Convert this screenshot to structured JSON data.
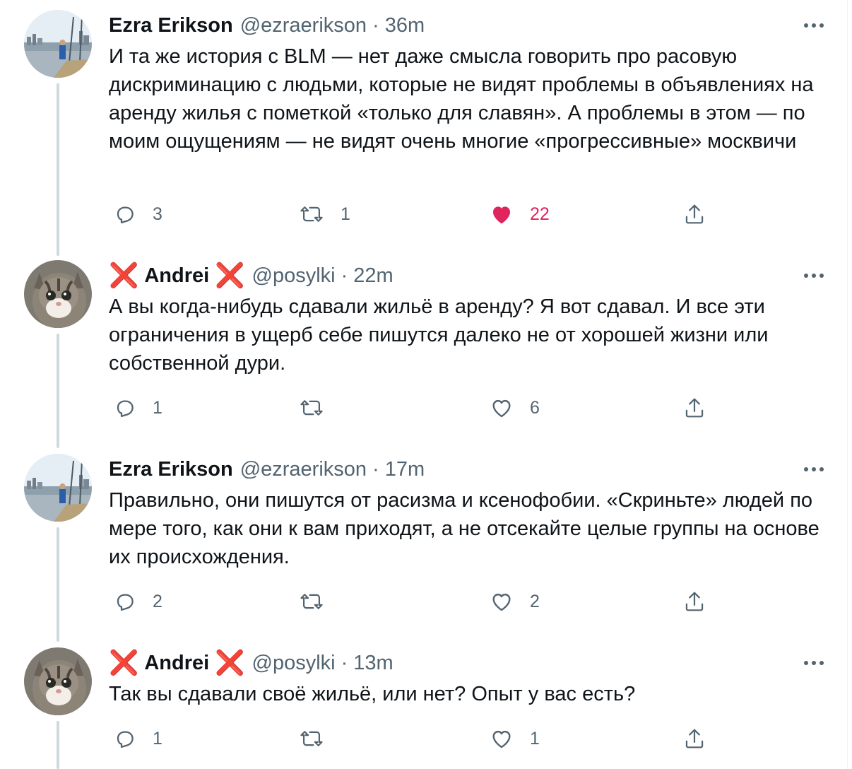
{
  "tweets": [
    {
      "name": "Ezra Erikson",
      "handle": "@ezraerikson",
      "time": "36m",
      "text": "И та же история с BLM — нет даже смысла говорить про расовую дискриминацию с людьми, которые не видят проблемы в объявлениях на аренду жилья с пометкой «только для славян». А проблемы в этом — по моим ощущениям — не видят очень многие «прогрессивные» москвичи",
      "replies": "3",
      "retweets": "1",
      "likes": "22",
      "liked": true
    },
    {
      "name": "Andrei",
      "handle": "@posylki",
      "time": "22m",
      "text": "А вы когда-нибудь сдавали жильё в аренду? Я вот сдавал. И все эти ограничения в ущерб себе пишутся далеко не от хорошей жизни или собственной дури.",
      "replies": "1",
      "retweets": "",
      "likes": "6",
      "liked": false
    },
    {
      "name": "Ezra Erikson",
      "handle": "@ezraerikson",
      "time": "17m",
      "text": "Правильно, они пишутся от расизма и ксенофобии. «Скриньте» людей по мере того, как они к вам приходят, а не отсекайте целые группы на основе их происхождения.",
      "replies": "2",
      "retweets": "",
      "likes": "2",
      "liked": false
    },
    {
      "name": "Andrei",
      "handle": "@posylki",
      "time": "13m",
      "text": "Так вы сдавали своё жильё, или нет? Опыт у вас есть?",
      "replies": "1",
      "retweets": "",
      "likes": "1",
      "liked": false
    }
  ],
  "name_decoration": "❌",
  "separator": "·",
  "icons": {
    "reply": "reply-icon",
    "retweet": "retweet-icon",
    "like": "heart-icon",
    "liked": "heart-filled-icon",
    "share": "share-icon",
    "more": "more-icon",
    "avatar_ezra": "harbor-photo",
    "avatar_andrei": "cat-photo"
  },
  "colors": {
    "text": "#0f1419",
    "secondary": "#536471",
    "like": "#e0245e",
    "thread_line": "#cfd9de"
  }
}
